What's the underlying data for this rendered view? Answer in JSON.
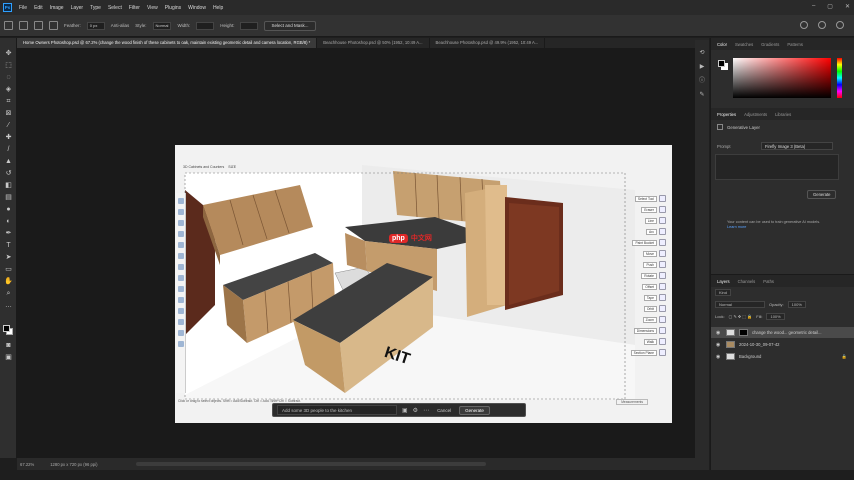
{
  "app": {
    "logo": "Ps"
  },
  "menu": [
    "File",
    "Edit",
    "Image",
    "Layer",
    "Type",
    "Select",
    "Filter",
    "View",
    "Plugins",
    "Window",
    "Help"
  ],
  "options_bar": {
    "feather_label": "Feather:",
    "feather_value": "0 px",
    "antialias_label": "Anti-alias",
    "style_label": "Style:",
    "style_value": "Normal",
    "width_label": "Width:",
    "height_label": "Height:",
    "select_mask_label": "Select and Mask..."
  },
  "tabs": [
    "Home Owners Photoshop.psd @ 67.2% (change the wood finish of these cabinets to oak, maintain existing geometric detail and camera location, RGB/8) *",
    "Beachhouse Photoshop.psd @ 50% (1952, 10:49 A...",
    "Beachhouse Photoshop.psd @ 49.9% (1952, 10:49 A..."
  ],
  "status_bar": {
    "zoom": "67.22%",
    "doc_size": "1280 px x 720 px (96 ppi)"
  },
  "contextual_bar": {
    "prompt_placeholder": "Add some 3D people to the kitchen",
    "cancel_label": "Cancel",
    "generate_label": "Generate"
  },
  "color_panel": {
    "tabs": [
      "Color",
      "Swatches",
      "Gradients",
      "Patterns"
    ],
    "foreground": "#000000",
    "background": "#ffffff"
  },
  "properties_panel": {
    "tabs": [
      "Properties",
      "Adjustments",
      "Libraries"
    ],
    "layer_type": "Generative Layer",
    "prompt_label": "Prompt",
    "model": "Firefly Image 3 (Beta)",
    "generate_label": "Generate",
    "notice_text": "Your content can be used to train generative AI models.",
    "notice_link": "Learn more"
  },
  "layers_panel": {
    "tabs": [
      "Layers",
      "Channels",
      "Paths"
    ],
    "filter_kind": "Kind",
    "blend_mode": "Normal",
    "opacity_label": "Opacity:",
    "opacity_value": "100%",
    "lock_label": "Lock:",
    "fill_label": "Fill:",
    "fill_value": "100%",
    "layers": [
      {
        "name": "change the wood... geometric detail...",
        "type": "generative",
        "selected": true
      },
      {
        "name": "2024-10-30_09-07-42",
        "type": "image",
        "selected": false
      },
      {
        "name": "Background",
        "type": "fill",
        "selected": false
      }
    ]
  },
  "sketchup": {
    "tab_title": "3D Cabinets and Counters",
    "tab_size": "SIZE",
    "right_labels": [
      "Select Tool",
      "Eraser",
      "Line",
      "Arc",
      "Paint Bucket",
      "Move",
      "Push",
      "Rotate",
      "Offset",
      "Tape",
      "Orbit",
      "Zoom",
      "Dimensions",
      "Walk",
      "Section Plane"
    ],
    "status": "Click or drag to select objects. Shift = Add/Subtract. Ctrl = Add. Shift+Ctrl = Subtract.",
    "measure_label": "Measurements",
    "floor_text": "KIT"
  },
  "watermark": {
    "brand": "php",
    "text": "中文网"
  }
}
